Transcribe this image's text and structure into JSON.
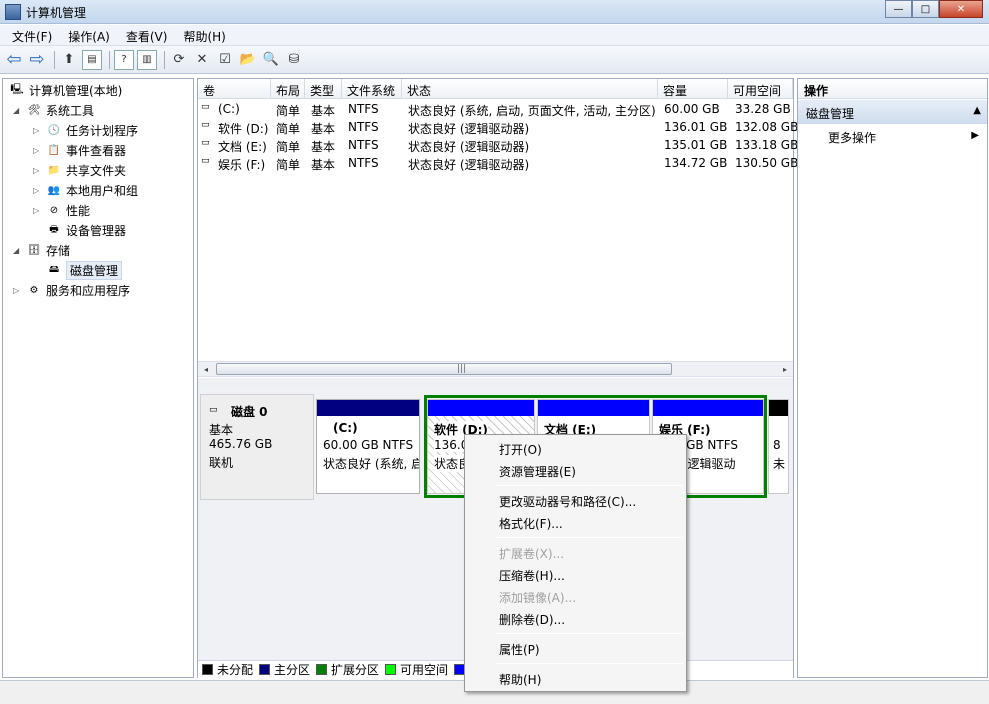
{
  "window": {
    "title": "计算机管理",
    "btn_min": "—",
    "btn_max": "□",
    "btn_close": "✕"
  },
  "menu": [
    "文件(F)",
    "操作(A)",
    "查看(V)",
    "帮助(H)"
  ],
  "toolbar": {
    "icons": [
      "back-arrow-icon",
      "forward-arrow-icon",
      "up-folder-icon",
      "show-hide-tree-icon",
      "help-icon",
      "show-hide-action-icon",
      "refresh-icon",
      "delete-icon",
      "properties-icon",
      "open-folder-icon",
      "find-icon",
      "disk-settings-icon"
    ],
    "back": "⇦",
    "forward": "⇨",
    "up": "⬆",
    "tree": "▤",
    "help": "?",
    "action": "▥",
    "refresh": "⟳",
    "delete": "✕",
    "props": "☑",
    "open": "📂",
    "find": "🔍",
    "disk": "⛁"
  },
  "tree": {
    "root": "计算机管理(本地)",
    "items": [
      {
        "label": "系统工具",
        "level": 1,
        "twisty": "◢"
      },
      {
        "label": "任务计划程序",
        "level": 2,
        "twisty": "▷"
      },
      {
        "label": "事件查看器",
        "level": 2,
        "twisty": "▷"
      },
      {
        "label": "共享文件夹",
        "level": 2,
        "twisty": "▷"
      },
      {
        "label": "本地用户和组",
        "level": 2,
        "twisty": "▷"
      },
      {
        "label": "性能",
        "level": 2,
        "twisty": "▷"
      },
      {
        "label": "设备管理器",
        "level": 2,
        "twisty": ""
      },
      {
        "label": "存储",
        "level": 1,
        "twisty": "◢"
      },
      {
        "label": "磁盘管理",
        "level": 2,
        "twisty": "",
        "selected": true
      },
      {
        "label": "服务和应用程序",
        "level": 1,
        "twisty": "▷"
      }
    ]
  },
  "volumes": {
    "columns": [
      "卷",
      "布局",
      "类型",
      "文件系统",
      "状态",
      "容量",
      "可用空间"
    ],
    "rows": [
      [
        "(C:)",
        "简单",
        "基本",
        "NTFS",
        "状态良好 (系统, 启动, 页面文件, 活动, 主分区)",
        "60.00 GB",
        "33.28 GB"
      ],
      [
        "软件 (D:)",
        "简单",
        "基本",
        "NTFS",
        "状态良好 (逻辑驱动器)",
        "136.01 GB",
        "132.08 GB"
      ],
      [
        "文档 (E:)",
        "简单",
        "基本",
        "NTFS",
        "状态良好 (逻辑驱动器)",
        "135.01 GB",
        "133.18 GB"
      ],
      [
        "娱乐 (F:)",
        "简单",
        "基本",
        "NTFS",
        "状态良好 (逻辑驱动器)",
        "134.72 GB",
        "130.50 GB"
      ]
    ],
    "scroll_left": "◂",
    "scroll_right": "▸",
    "grip": "|||"
  },
  "disk": {
    "name": "磁盘 0",
    "type": "基本",
    "size": "465.76 GB",
    "status": "联机",
    "partitions": [
      {
        "title": "(C:)",
        "size": "60.00 GB NTFS",
        "status": "状态良好 (系统, 启"
      },
      {
        "title": "软件  (D:)",
        "size": "136.0",
        "status": "状态良"
      },
      {
        "title": "文档  (E:)",
        "size": "",
        "status": ""
      },
      {
        "title": "娱乐  (F:)",
        "size": "72 GB NTFS",
        "status": "好 (逻辑驱动"
      },
      {
        "title": "",
        "size": "8",
        "status": "未"
      }
    ]
  },
  "legend": [
    {
      "label": "未分配",
      "color": "#000000"
    },
    {
      "label": "主分区",
      "color": "#000080"
    },
    {
      "label": "扩展分区",
      "color": "#008000"
    },
    {
      "label": "可用空间",
      "color": "#00ff00"
    }
  ],
  "actions": {
    "title": "操作",
    "section": "磁盘管理",
    "section_arrow": "▲",
    "more": "更多操作",
    "more_arrow": "▶"
  },
  "context_menu": [
    {
      "label": "打开(O)",
      "disabled": false
    },
    {
      "label": "资源管理器(E)",
      "disabled": false
    },
    {
      "label": "更改驱动器号和路径(C)...",
      "disabled": false
    },
    {
      "label": "格式化(F)...",
      "disabled": false
    },
    {
      "label": "扩展卷(X)...",
      "disabled": true
    },
    {
      "label": "压缩卷(H)...",
      "disabled": false
    },
    {
      "label": "添加镜像(A)...",
      "disabled": true
    },
    {
      "label": "删除卷(D)...",
      "disabled": false
    },
    {
      "label": "属性(P)",
      "disabled": false
    },
    {
      "label": "帮助(H)",
      "disabled": false
    }
  ],
  "colors": {
    "primary": "#000080",
    "logical": "#0000ff",
    "extended": "#008000",
    "unallocated": "#000000"
  }
}
